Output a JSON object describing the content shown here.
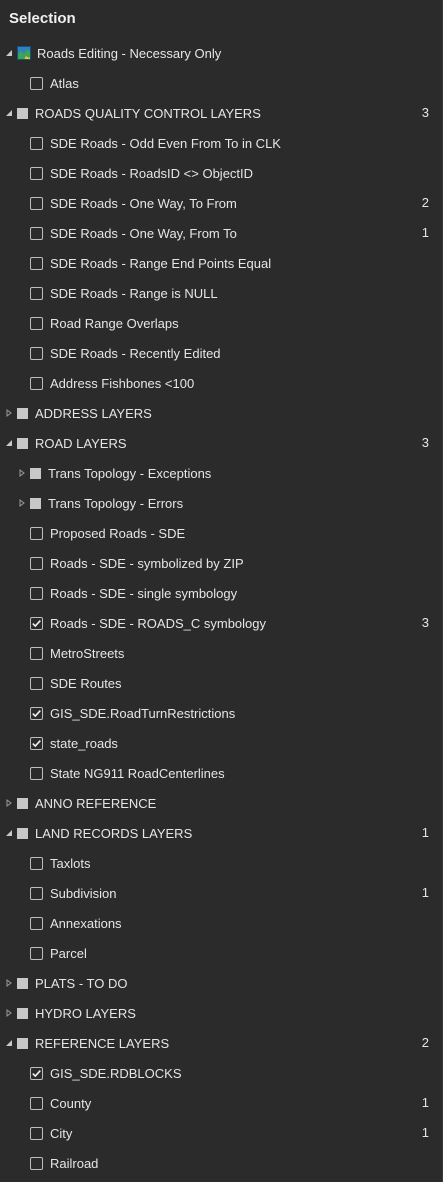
{
  "panel": {
    "title": "Selection"
  },
  "map": {
    "label": "Roads Editing - Necessary Only"
  },
  "tree": [
    {
      "label": "Atlas",
      "level": 1,
      "kind": "layer",
      "checked": false,
      "count": ""
    },
    {
      "label": "ROADS QUALITY CONTROL LAYERS",
      "level": 0,
      "kind": "group",
      "expanded": true,
      "count": "3"
    },
    {
      "label": "SDE Roads - Odd Even From To in CLK",
      "level": 1,
      "kind": "layer",
      "checked": false,
      "count": ""
    },
    {
      "label": "SDE Roads - RoadsID <> ObjectID",
      "level": 1,
      "kind": "layer",
      "checked": false,
      "count": ""
    },
    {
      "label": "SDE Roads - One Way, To From",
      "level": 1,
      "kind": "layer",
      "checked": false,
      "count": "2"
    },
    {
      "label": "SDE Roads - One Way, From To",
      "level": 1,
      "kind": "layer",
      "checked": false,
      "count": "1"
    },
    {
      "label": "SDE Roads - Range End Points Equal",
      "level": 1,
      "kind": "layer",
      "checked": false,
      "count": ""
    },
    {
      "label": "SDE Roads - Range is NULL",
      "level": 1,
      "kind": "layer",
      "checked": false,
      "count": ""
    },
    {
      "label": "Road Range Overlaps",
      "level": 1,
      "kind": "layer",
      "checked": false,
      "count": ""
    },
    {
      "label": "SDE Roads - Recently Edited",
      "level": 1,
      "kind": "layer",
      "checked": false,
      "count": ""
    },
    {
      "label": "Address Fishbones <100",
      "level": 1,
      "kind": "layer",
      "checked": false,
      "count": ""
    },
    {
      "label": "ADDRESS LAYERS",
      "level": 0,
      "kind": "group",
      "expanded": false,
      "count": ""
    },
    {
      "label": "ROAD LAYERS",
      "level": 0,
      "kind": "group",
      "expanded": true,
      "count": "3"
    },
    {
      "label": "Trans Topology - Exceptions",
      "level": 1,
      "kind": "group",
      "expanded": false,
      "count": ""
    },
    {
      "label": "Trans Topology - Errors",
      "level": 1,
      "kind": "group",
      "expanded": false,
      "count": ""
    },
    {
      "label": "Proposed Roads - SDE",
      "level": 1,
      "kind": "layer",
      "checked": false,
      "count": ""
    },
    {
      "label": "Roads - SDE - symbolized by ZIP",
      "level": 1,
      "kind": "layer",
      "checked": false,
      "count": ""
    },
    {
      "label": "Roads - SDE - single symbology",
      "level": 1,
      "kind": "layer",
      "checked": false,
      "count": ""
    },
    {
      "label": "Roads - SDE - ROADS_C symbology",
      "level": 1,
      "kind": "layer",
      "checked": true,
      "count": "3"
    },
    {
      "label": "MetroStreets",
      "level": 1,
      "kind": "layer",
      "checked": false,
      "count": ""
    },
    {
      "label": "SDE Routes",
      "level": 1,
      "kind": "layer",
      "checked": false,
      "count": ""
    },
    {
      "label": "GIS_SDE.RoadTurnRestrictions",
      "level": 1,
      "kind": "layer",
      "checked": true,
      "count": ""
    },
    {
      "label": "state_roads",
      "level": 1,
      "kind": "layer",
      "checked": true,
      "count": ""
    },
    {
      "label": "State NG911 RoadCenterlines",
      "level": 1,
      "kind": "layer",
      "checked": false,
      "count": ""
    },
    {
      "label": "ANNO REFERENCE",
      "level": 0,
      "kind": "group",
      "expanded": false,
      "count": ""
    },
    {
      "label": "LAND RECORDS LAYERS",
      "level": 0,
      "kind": "group",
      "expanded": true,
      "count": "1"
    },
    {
      "label": "Taxlots",
      "level": 1,
      "kind": "layer",
      "checked": false,
      "count": ""
    },
    {
      "label": "Subdivision",
      "level": 1,
      "kind": "layer",
      "checked": false,
      "count": "1"
    },
    {
      "label": "Annexations",
      "level": 1,
      "kind": "layer",
      "checked": false,
      "count": ""
    },
    {
      "label": "Parcel",
      "level": 1,
      "kind": "layer",
      "checked": false,
      "count": ""
    },
    {
      "label": "PLATS - TO DO",
      "level": 0,
      "kind": "group",
      "expanded": false,
      "count": ""
    },
    {
      "label": "HYDRO LAYERS",
      "level": 0,
      "kind": "group",
      "expanded": false,
      "count": ""
    },
    {
      "label": "REFERENCE LAYERS",
      "level": 0,
      "kind": "group",
      "expanded": true,
      "count": "2"
    },
    {
      "label": "GIS_SDE.RDBLOCKS",
      "level": 1,
      "kind": "layer",
      "checked": true,
      "count": ""
    },
    {
      "label": "County",
      "level": 1,
      "kind": "layer",
      "checked": false,
      "count": "1"
    },
    {
      "label": "City",
      "level": 1,
      "kind": "layer",
      "checked": false,
      "count": "1"
    },
    {
      "label": "Railroad",
      "level": 1,
      "kind": "layer",
      "checked": false,
      "count": ""
    }
  ],
  "colors": {
    "background": "#2b2b2b",
    "text": "#e6e6e6",
    "checkbox_border": "#bdbdbd",
    "group_square": "#c8c8c8"
  },
  "icons": {
    "map": "map-icon",
    "expanded": "triangle-down-icon",
    "collapsed": "triangle-right-icon",
    "checked": "checkmark-icon"
  }
}
